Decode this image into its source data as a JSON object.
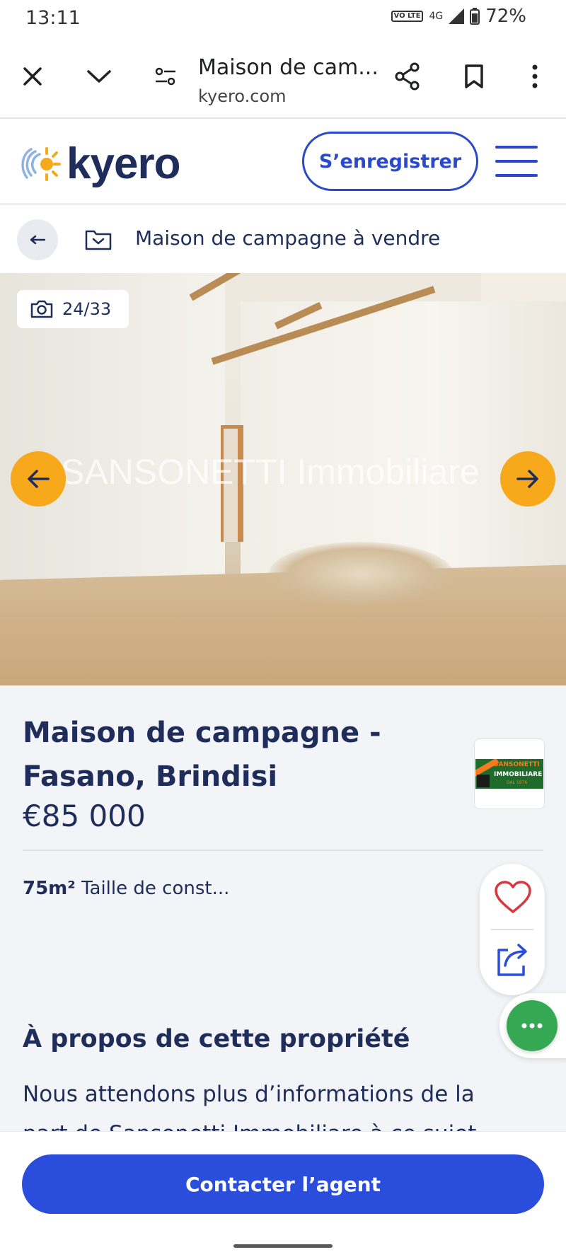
{
  "status_bar": {
    "time": "13:11",
    "volte": "VO LTE",
    "network": "4G",
    "battery": "72%"
  },
  "browser": {
    "title": "Maison de cam...",
    "url": "kyero.com"
  },
  "site": {
    "logo_text": "kyero",
    "register_label": "S’enregistrer"
  },
  "breadcrumb": {
    "label": "Maison de campagne à vendre"
  },
  "gallery": {
    "counter": "24/33",
    "watermark": "SANSONETTI Immobiliare"
  },
  "listing": {
    "title": "Maison de campagne - Fasano, Brindisi",
    "price": "€85 000",
    "size_value": "75m²",
    "size_label": "Taille de const...",
    "agency_logo_text": [
      "SANSONETTI",
      "IMMOBILIARE",
      "DAL 1976"
    ]
  },
  "about": {
    "heading": "À propos de cette propriété",
    "text": "Nous attendons plus d’informations de la part de Sansonetti Immobiliare à ce sujet"
  },
  "footer": {
    "contact_label": "Contacter l’agent"
  },
  "colors": {
    "brand_navy": "#1f2d5a",
    "brand_blue": "#2a4ddb",
    "accent_orange": "#f7a81b",
    "heart_red": "#d9363e",
    "chat_green": "#34a853"
  }
}
